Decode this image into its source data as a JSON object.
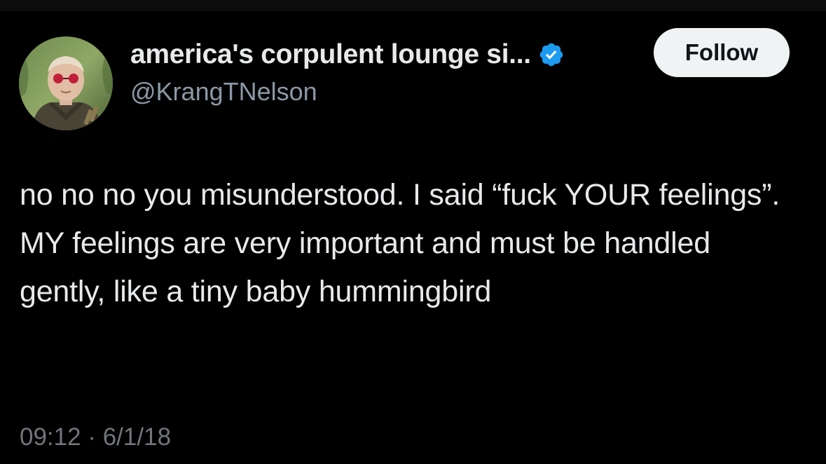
{
  "tweet": {
    "author": {
      "display_name": "america's corpulent lounge si...",
      "handle": "@KrangTNelson",
      "verified": true,
      "avatar_icon": "profile-photo-avatar"
    },
    "follow_label": "Follow",
    "text": "no no no you misunderstood. I said “fuck YOUR feelings”. MY feelings are very important and must be handled gently, like a tiny baby hummingbird",
    "time": "09:12",
    "separator": "·",
    "date": "6/1/18"
  },
  "colors": {
    "background": "#000000",
    "primary_text": "#e7e9ea",
    "secondary_text": "#8b98a5",
    "timestamp_text": "#71767b",
    "verified_badge": "#1d9bf0",
    "follow_button_bg": "#eff3f4",
    "follow_button_text": "#0f1419"
  }
}
